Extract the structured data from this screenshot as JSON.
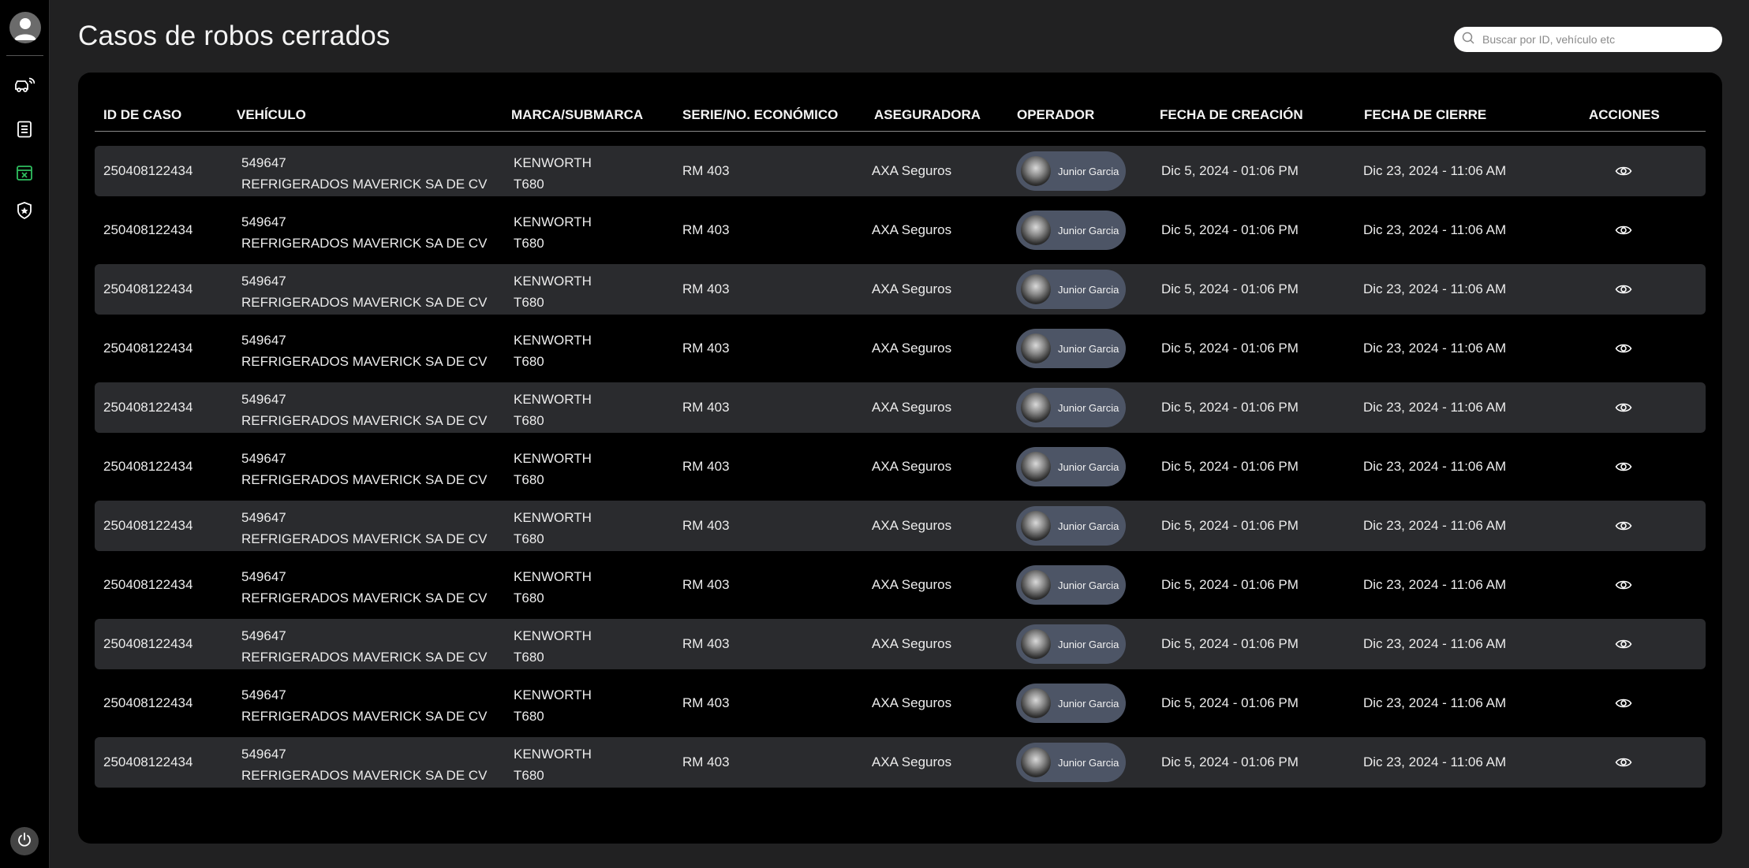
{
  "page": {
    "title": "Casos de robos cerrados"
  },
  "search": {
    "placeholder": "Buscar por ID, vehículo etc"
  },
  "sidebar": {
    "items": [
      {
        "icon": "user-avatar-icon"
      },
      {
        "icon": "truck-signal-icon"
      },
      {
        "icon": "document-list-icon"
      },
      {
        "icon": "closed-case-icon",
        "active": true,
        "color": "#2fbf5f"
      },
      {
        "icon": "shield-badge-icon"
      },
      {
        "icon": "power-icon"
      }
    ]
  },
  "table": {
    "headers": {
      "id": "ID DE CASO",
      "vehicle": "VEHÍCULO",
      "brand": "MARCA/SUBMARCA",
      "serial": "SERIE/NO. ECONÓMICO",
      "insurer": "ASEGURADORA",
      "operator": "OPERADOR",
      "created": "FECHA DE CREACIÓN",
      "closed": "FECHA DE CIERRE",
      "actions": "ACCIONES"
    },
    "rows": [
      {
        "id": "250408122434",
        "vehicle_number": "549647",
        "vehicle_company": "REFRIGERADOS MAVERICK SA DE CV",
        "brand": "KENWORTH",
        "submodel": "T680",
        "serial": "RM 403",
        "insurer": "AXA Seguros",
        "operator": "Junior Garcia",
        "created": "Dic 5, 2024 - 01:06 PM",
        "closed": "Dic 23, 2024 - 11:06 AM"
      },
      {
        "id": "250408122434",
        "vehicle_number": "549647",
        "vehicle_company": "REFRIGERADOS MAVERICK SA DE CV",
        "brand": "KENWORTH",
        "submodel": "T680",
        "serial": "RM 403",
        "insurer": "AXA Seguros",
        "operator": "Junior Garcia",
        "created": "Dic 5, 2024 - 01:06 PM",
        "closed": "Dic 23, 2024 - 11:06 AM"
      },
      {
        "id": "250408122434",
        "vehicle_number": "549647",
        "vehicle_company": "REFRIGERADOS MAVERICK SA DE CV",
        "brand": "KENWORTH",
        "submodel": "T680",
        "serial": "RM 403",
        "insurer": "AXA Seguros",
        "operator": "Junior Garcia",
        "created": "Dic 5, 2024 - 01:06 PM",
        "closed": "Dic 23, 2024 - 11:06 AM"
      },
      {
        "id": "250408122434",
        "vehicle_number": "549647",
        "vehicle_company": "REFRIGERADOS MAVERICK SA DE CV",
        "brand": "KENWORTH",
        "submodel": "T680",
        "serial": "RM 403",
        "insurer": "AXA Seguros",
        "operator": "Junior Garcia",
        "created": "Dic 5, 2024 - 01:06 PM",
        "closed": "Dic 23, 2024 - 11:06 AM"
      },
      {
        "id": "250408122434",
        "vehicle_number": "549647",
        "vehicle_company": "REFRIGERADOS MAVERICK SA DE CV",
        "brand": "KENWORTH",
        "submodel": "T680",
        "serial": "RM 403",
        "insurer": "AXA Seguros",
        "operator": "Junior Garcia",
        "created": "Dic 5, 2024 - 01:06 PM",
        "closed": "Dic 23, 2024 - 11:06 AM"
      },
      {
        "id": "250408122434",
        "vehicle_number": "549647",
        "vehicle_company": "REFRIGERADOS MAVERICK SA DE CV",
        "brand": "KENWORTH",
        "submodel": "T680",
        "serial": "RM 403",
        "insurer": "AXA Seguros",
        "operator": "Junior Garcia",
        "created": "Dic 5, 2024 - 01:06 PM",
        "closed": "Dic 23, 2024 - 11:06 AM"
      },
      {
        "id": "250408122434",
        "vehicle_number": "549647",
        "vehicle_company": "REFRIGERADOS MAVERICK SA DE CV",
        "brand": "KENWORTH",
        "submodel": "T680",
        "serial": "RM 403",
        "insurer": "AXA Seguros",
        "operator": "Junior Garcia",
        "created": "Dic 5, 2024 - 01:06 PM",
        "closed": "Dic 23, 2024 - 11:06 AM"
      },
      {
        "id": "250408122434",
        "vehicle_number": "549647",
        "vehicle_company": "REFRIGERADOS MAVERICK SA DE CV",
        "brand": "KENWORTH",
        "submodel": "T680",
        "serial": "RM 403",
        "insurer": "AXA Seguros",
        "operator": "Junior Garcia",
        "created": "Dic 5, 2024 - 01:06 PM",
        "closed": "Dic 23, 2024 - 11:06 AM"
      },
      {
        "id": "250408122434",
        "vehicle_number": "549647",
        "vehicle_company": "REFRIGERADOS MAVERICK SA DE CV",
        "brand": "KENWORTH",
        "submodel": "T680",
        "serial": "RM 403",
        "insurer": "AXA Seguros",
        "operator": "Junior Garcia",
        "created": "Dic 5, 2024 - 01:06 PM",
        "closed": "Dic 23, 2024 - 11:06 AM"
      },
      {
        "id": "250408122434",
        "vehicle_number": "549647",
        "vehicle_company": "REFRIGERADOS MAVERICK SA DE CV",
        "brand": "KENWORTH",
        "submodel": "T680",
        "serial": "RM 403",
        "insurer": "AXA Seguros",
        "operator": "Junior Garcia",
        "created": "Dic 5, 2024 - 01:06 PM",
        "closed": "Dic 23, 2024 - 11:06 AM"
      },
      {
        "id": "250408122434",
        "vehicle_number": "549647",
        "vehicle_company": "REFRIGERADOS MAVERICK SA DE CV",
        "brand": "KENWORTH",
        "submodel": "T680",
        "serial": "RM 403",
        "insurer": "AXA Seguros",
        "operator": "Junior Garcia",
        "created": "Dic 5, 2024 - 01:06 PM",
        "closed": "Dic 23, 2024 - 11:06 AM"
      }
    ]
  }
}
